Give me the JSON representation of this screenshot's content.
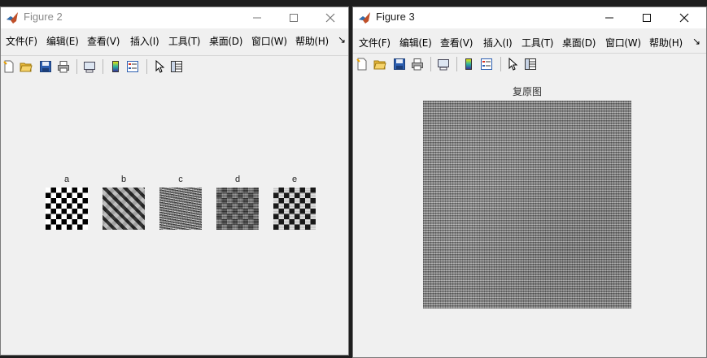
{
  "windows": [
    {
      "id": "figure2",
      "title": "Figure 2",
      "menu": [
        "文件(F)",
        "编辑(E)",
        "查看(V)",
        "插入(I)",
        "工具(T)",
        "桌面(D)",
        "窗口(W)",
        "帮助(H)"
      ],
      "menu_overflow": "↘",
      "subplots": [
        {
          "label": "a",
          "style": "checker"
        },
        {
          "label": "b",
          "style": "blurred"
        },
        {
          "label": "c",
          "style": "noise"
        },
        {
          "label": "d",
          "style": "noisy-checker"
        },
        {
          "label": "e",
          "style": "soft-checker"
        }
      ]
    },
    {
      "id": "figure3",
      "title": "Figure 3",
      "menu": [
        "文件(F)",
        "编辑(E)",
        "查看(V)",
        "插入(I)",
        "工具(T)",
        "桌面(D)",
        "窗口(W)",
        "帮助(H)"
      ],
      "menu_overflow": "↘",
      "image_title": "复原图"
    }
  ],
  "toolbar_icons": [
    "new-figure-icon",
    "open-file-icon",
    "save-icon",
    "print-icon",
    "link-plot-icon",
    "insert-colorbar-icon",
    "insert-legend-icon",
    "edit-plot-icon",
    "property-inspector-icon"
  ],
  "colors": {
    "matlab_orange": "#d95319",
    "window_bg": "#f0f0f0",
    "titlebar": "#ffffff",
    "desktop": "#1e1e1e"
  }
}
